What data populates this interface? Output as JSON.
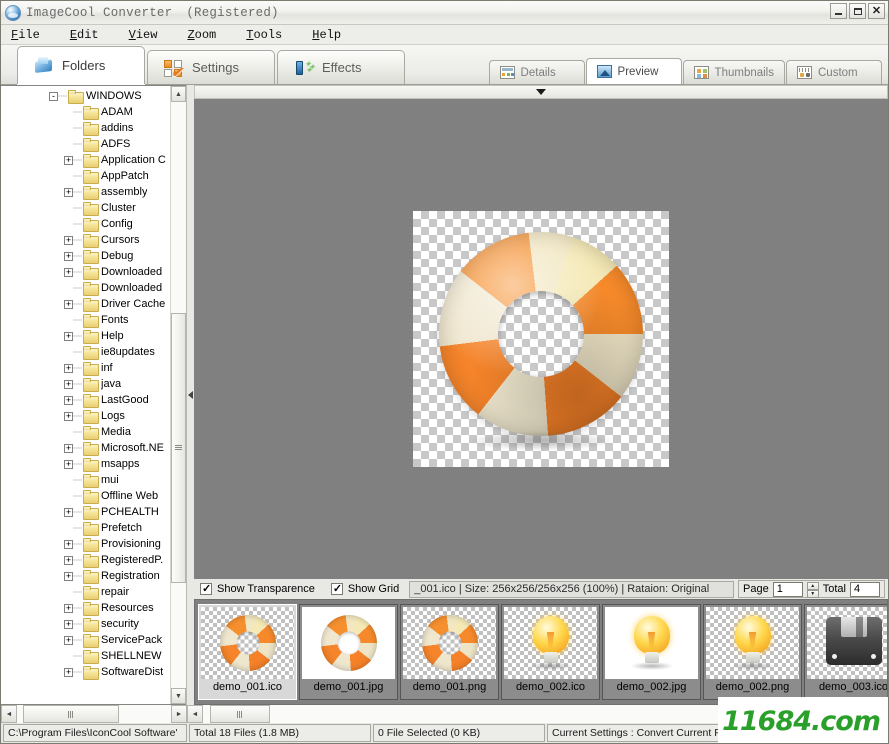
{
  "window": {
    "title": "ImageCool Converter",
    "registered": "(Registered)",
    "minimize_label": "",
    "maximize_label": "",
    "close_label": "✕"
  },
  "menu": [
    {
      "label": "File",
      "accel": "F"
    },
    {
      "label": "Edit",
      "accel": "E"
    },
    {
      "label": "View",
      "accel": "V"
    },
    {
      "label": "Zoom",
      "accel": "Z"
    },
    {
      "label": "Tools",
      "accel": "T"
    },
    {
      "label": "Help",
      "accel": "H"
    }
  ],
  "main_tabs": [
    {
      "label": "Folders",
      "icon": "folders-icon",
      "active": true
    },
    {
      "label": "Settings",
      "icon": "settings-icon",
      "active": false
    },
    {
      "label": "Effects",
      "icon": "effects-icon",
      "active": false
    }
  ],
  "view_tabs": [
    {
      "label": "Details",
      "icon": "details-icon",
      "active": false
    },
    {
      "label": "Preview",
      "icon": "preview-icon",
      "active": true
    },
    {
      "label": "Thumbnails",
      "icon": "thumbnails-icon",
      "active": false
    },
    {
      "label": "Custom",
      "icon": "custom-icon",
      "active": false
    }
  ],
  "tree": {
    "root": {
      "label": "WINDOWS",
      "expander": "−",
      "depth": 0
    },
    "nodes": [
      {
        "label": "WINDOWS",
        "expander": "-",
        "depth": 0
      },
      {
        "label": "ADAM",
        "expander": "",
        "depth": 1
      },
      {
        "label": "addins",
        "expander": "",
        "depth": 1
      },
      {
        "label": "ADFS",
        "expander": "",
        "depth": 1
      },
      {
        "label": "Application C",
        "expander": "+",
        "depth": 1
      },
      {
        "label": "AppPatch",
        "expander": "",
        "depth": 1
      },
      {
        "label": "assembly",
        "expander": "+",
        "depth": 1
      },
      {
        "label": "Cluster",
        "expander": "",
        "depth": 1
      },
      {
        "label": "Config",
        "expander": "",
        "depth": 1
      },
      {
        "label": "Cursors",
        "expander": "+",
        "depth": 1
      },
      {
        "label": "Debug",
        "expander": "+",
        "depth": 1
      },
      {
        "label": "Downloaded",
        "expander": "+",
        "depth": 1
      },
      {
        "label": "Downloaded",
        "expander": "",
        "depth": 1
      },
      {
        "label": "Driver Cache",
        "expander": "+",
        "depth": 1
      },
      {
        "label": "Fonts",
        "expander": "",
        "depth": 1
      },
      {
        "label": "Help",
        "expander": "+",
        "depth": 1
      },
      {
        "label": "ie8updates",
        "expander": "",
        "depth": 1
      },
      {
        "label": "inf",
        "expander": "+",
        "depth": 1
      },
      {
        "label": "java",
        "expander": "+",
        "depth": 1
      },
      {
        "label": "LastGood",
        "expander": "+",
        "depth": 1
      },
      {
        "label": "Logs",
        "expander": "+",
        "depth": 1
      },
      {
        "label": "Media",
        "expander": "",
        "depth": 1
      },
      {
        "label": "Microsoft.NE",
        "expander": "+",
        "depth": 1
      },
      {
        "label": "msapps",
        "expander": "+",
        "depth": 1
      },
      {
        "label": "mui",
        "expander": "",
        "depth": 1
      },
      {
        "label": "Offline Web",
        "expander": "",
        "depth": 1
      },
      {
        "label": "PCHEALTH",
        "expander": "+",
        "depth": 1
      },
      {
        "label": "Prefetch",
        "expander": "",
        "depth": 1
      },
      {
        "label": "Provisioning",
        "expander": "+",
        "depth": 1
      },
      {
        "label": "RegisteredP.",
        "expander": "+",
        "depth": 1
      },
      {
        "label": "Registration",
        "expander": "+",
        "depth": 1
      },
      {
        "label": "repair",
        "expander": "",
        "depth": 1
      },
      {
        "label": "Resources",
        "expander": "+",
        "depth": 1
      },
      {
        "label": "security",
        "expander": "+",
        "depth": 1
      },
      {
        "label": "ServicePack",
        "expander": "+",
        "depth": 1
      },
      {
        "label": "SHELLNEW",
        "expander": "",
        "depth": 1
      },
      {
        "label": "SoftwareDist",
        "expander": "+",
        "depth": 1
      }
    ]
  },
  "preview": {
    "image_name": "demo_001.ico",
    "collapse_handle": "▼"
  },
  "options": {
    "show_transparence": {
      "label": "Show Transparence",
      "checked": true
    },
    "show_grid": {
      "label": "Show Grid",
      "checked": true
    }
  },
  "info_text": "_001.ico  |  Size: 256x256/256x256 (100%)  |  Rataion: Original",
  "pager": {
    "page_label": "Page",
    "page_value": "1",
    "total_label": "Total",
    "total_value": "4",
    "spin_up": "▲",
    "spin_down": "▼"
  },
  "thumbnails": [
    {
      "caption": "demo_001.ico",
      "kind": "ring",
      "bg": "checker",
      "selected": true
    },
    {
      "caption": "demo_001.jpg",
      "kind": "ring",
      "bg": "white",
      "selected": false
    },
    {
      "caption": "demo_001.png",
      "kind": "ring",
      "bg": "checker",
      "selected": false
    },
    {
      "caption": "demo_002.ico",
      "kind": "bulb",
      "bg": "checker",
      "selected": false
    },
    {
      "caption": "demo_002.jpg",
      "kind": "bulb",
      "bg": "white",
      "selected": false
    },
    {
      "caption": "demo_002.png",
      "kind": "bulb",
      "bg": "checker",
      "selected": false
    },
    {
      "caption": "demo_003.ico",
      "kind": "floppy",
      "bg": "checker",
      "selected": false
    }
  ],
  "statusbar": {
    "path": "C:\\Program Files\\IconCool Software'",
    "total_files": "Total 18 Files (1.8 MB)",
    "selected": "0 File Selected (0 KB)",
    "current_settings": "Current Settings : Convert Current File to"
  },
  "watermark": {
    "text": "11684.com",
    "color": "#2aa02a"
  },
  "scroll_glyphs": {
    "up": "▲",
    "down": "▼",
    "left": "◄",
    "right": "►"
  }
}
